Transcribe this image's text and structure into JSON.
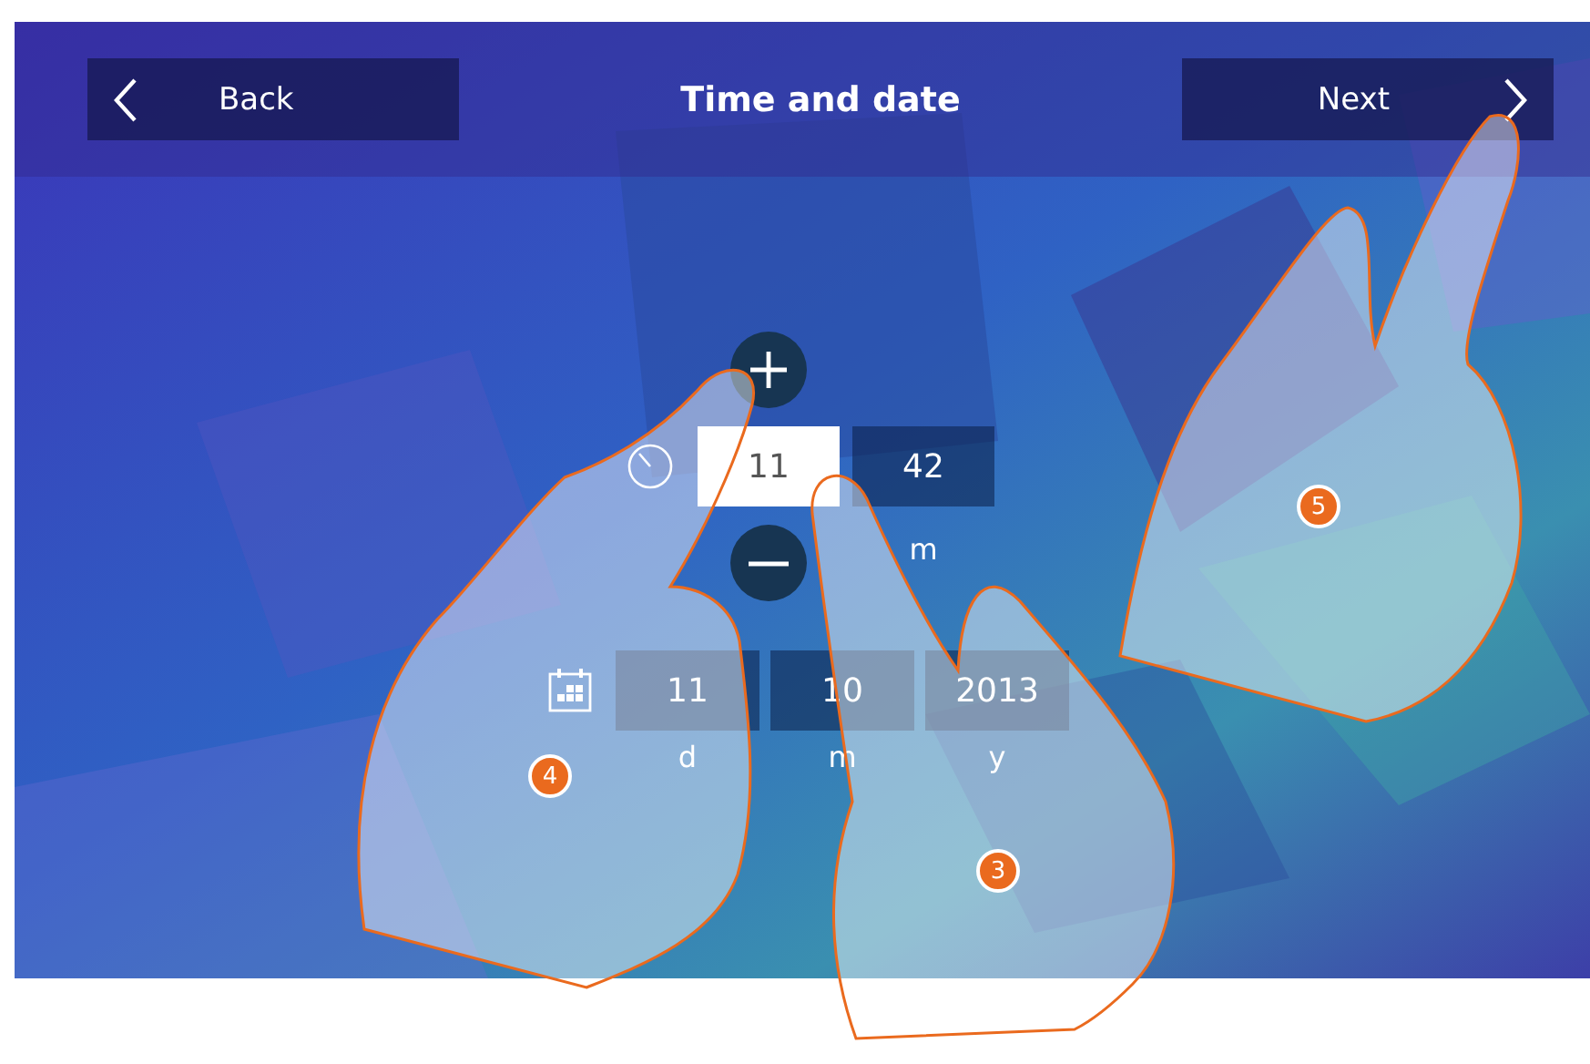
{
  "header": {
    "back": {
      "label": "Back"
    },
    "title": "Time and date",
    "next": {
      "label": "Next"
    }
  },
  "time": {
    "fields": [
      {
        "value": "11",
        "selected": true
      },
      {
        "value": "42",
        "selected": false,
        "label": "m"
      }
    ]
  },
  "date": {
    "fields": [
      {
        "value": "11",
        "selected": false,
        "label": "d"
      },
      {
        "value": "10",
        "selected": false,
        "label": "m"
      },
      {
        "value": "2013",
        "selected": false,
        "label": "y"
      }
    ]
  },
  "callouts": [
    {
      "number": "4"
    },
    {
      "number": "3"
    },
    {
      "number": "5"
    }
  ]
}
